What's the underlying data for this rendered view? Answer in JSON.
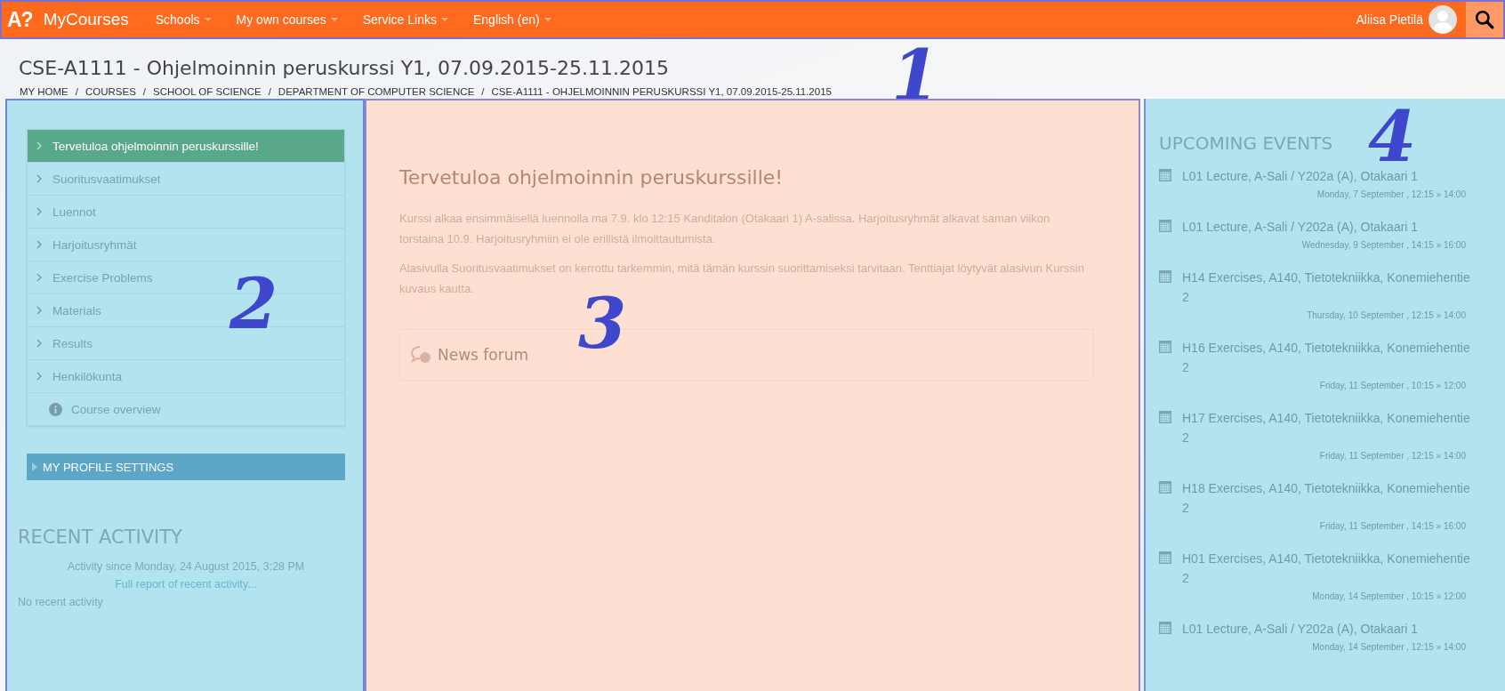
{
  "topbar": {
    "logo": "A?",
    "site_name": "MyCourses",
    "annotation": "1",
    "menus": [
      {
        "label": "Schools"
      },
      {
        "label": "My own courses"
      },
      {
        "label": "Service Links"
      },
      {
        "label": "English (en)"
      }
    ],
    "user_name": "Aliisa Pietilä"
  },
  "page_title": "CSE-A1111 - Ohjelmoinnin peruskurssi Y1, 07.09.2015-25.11.2015",
  "breadcrumbs": {
    "separator": "/",
    "items": [
      "MY HOME",
      "COURSES",
      "SCHOOL OF SCIENCE",
      "DEPARTMENT OF COMPUTER SCIENCE",
      "CSE-A1111 - OHJELMOINNIN PERUSKURSSI Y1, 07.09.2015-25.11.2015"
    ]
  },
  "left": {
    "annotation": "2",
    "course_menu": [
      {
        "kind": "section",
        "label": "Tervetuloa ohjelmoinnin peruskurssille!",
        "selected": true
      },
      {
        "kind": "section",
        "label": "Suoritusvaatimukset",
        "selected": false
      },
      {
        "kind": "section",
        "label": "Luennot",
        "selected": false
      },
      {
        "kind": "section",
        "label": "Harjoitusryhmät",
        "selected": false
      },
      {
        "kind": "section",
        "label": "Exercise Problems",
        "selected": false
      },
      {
        "kind": "section",
        "label": "Materials",
        "selected": false
      },
      {
        "kind": "section",
        "label": "Results",
        "selected": false
      },
      {
        "kind": "section",
        "label": "Henkilökunta",
        "selected": false
      },
      {
        "kind": "info",
        "label": "Course overview",
        "selected": false
      }
    ],
    "profile_settings": {
      "label": "MY PROFILE SETTINGS",
      "expanded": false
    },
    "recent_activity": {
      "title": "RECENT ACTIVITY",
      "since": "Activity since Monday, 24 August 2015, 3:28 PM",
      "report_link": "Full report of recent activity...",
      "empty": "No recent activity"
    }
  },
  "main": {
    "annotation": "3",
    "heading": "Tervetuloa ohjelmoinnin peruskurssille!",
    "paragraphs": [
      "Kurssi alkaa ensimmäisellä luennolla ma 7.9. klo 12:15 Kanditalon (Otakaari 1) A-salissa. Harjoitusryhmät alkavat saman viikon torstaina 10.9. Harjoitusryhmiin ei ole erillistä ilmoittautumista.",
      "Alasivulla Suoritusvaatimukset on kerrottu tarkemmin, mitä tämän kurssin suorittamiseksi tarvitaan. Tenttiajat löytyvät alasivun Kurssin kuvaus kautta."
    ],
    "forum": {
      "label": "News forum"
    }
  },
  "right": {
    "annotation": "4",
    "title": "UPCOMING EVENTS",
    "events": [
      {
        "title": "L01 Lecture, A-Sali / Y202a (A), Otakaari 1",
        "when": "Monday, 7 September , 12:15 » 14:00"
      },
      {
        "title": "L01 Lecture, A-Sali / Y202a (A), Otakaari 1",
        "when": "Wednesday, 9 September , 14:15 » 16:00"
      },
      {
        "title": "H14 Exercises, A140, Tietotekniikka, Konemiehentie 2",
        "when": "Thursday, 10 September , 12:15 » 14:00"
      },
      {
        "title": "H16 Exercises, A140, Tietotekniikka, Konemiehentie 2",
        "when": "Friday, 11 September , 10:15 » 12:00"
      },
      {
        "title": "H17 Exercises, A140, Tietotekniikka, Konemiehentie 2",
        "when": "Friday, 11 September , 12:15 » 14:00"
      },
      {
        "title": "H18 Exercises, A140, Tietotekniikka, Konemiehentie 2",
        "when": "Friday, 11 September , 14:15 » 16:00"
      },
      {
        "title": "H01 Exercises, A140, Tietotekniikka, Konemiehentie 2",
        "when": "Monday, 14 September , 10:15 » 12:00"
      },
      {
        "title": "L01 Lecture, A-Sali / Y202a (A), Otakaari 1",
        "when": "Monday, 14 September , 12:15 » 14:00"
      }
    ]
  }
}
